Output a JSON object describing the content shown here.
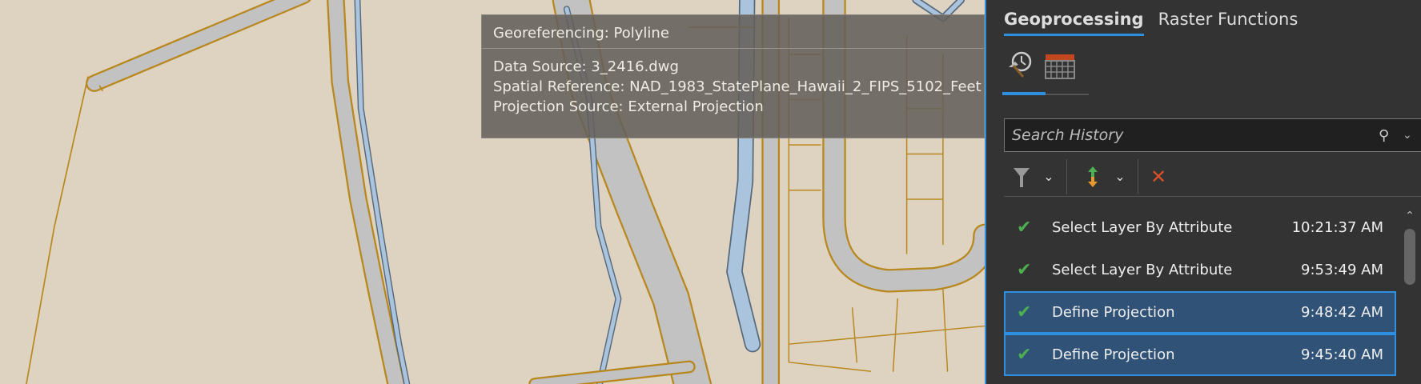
{
  "tooltip": {
    "title": "Georeferencing: Polyline",
    "lines": [
      "Data Source: 3_2416.dwg",
      "Spatial Reference: NAD_1983_StatePlane_Hawaii_2_FIPS_5102_Feet",
      "Projection Source: External Projection"
    ]
  },
  "panel": {
    "tabs": [
      {
        "label": "Geoprocessing",
        "active": true
      },
      {
        "label": "Raster Functions",
        "active": false
      }
    ],
    "subtabs": [
      "history-icon",
      "scheduled-icon"
    ],
    "search": {
      "placeholder": "Search History",
      "value": ""
    },
    "history": [
      {
        "name": "Select Layer By Attribute",
        "time": "10:21:37 AM",
        "status": "success",
        "selected": false
      },
      {
        "name": "Select Layer By Attribute",
        "time": "9:53:49 AM",
        "status": "success",
        "selected": false
      },
      {
        "name": "Define Projection",
        "time": "9:48:42 AM",
        "status": "success",
        "selected": true
      },
      {
        "name": "Define Projection",
        "time": "9:45:40 AM",
        "status": "success",
        "selected": true
      }
    ]
  },
  "colors": {
    "accent": "#2f8fe0",
    "success": "#4caf50",
    "delete": "#d9502a",
    "road": "#bfbfbf",
    "parcel": "#b8871d",
    "water": "#a9c4dc"
  }
}
